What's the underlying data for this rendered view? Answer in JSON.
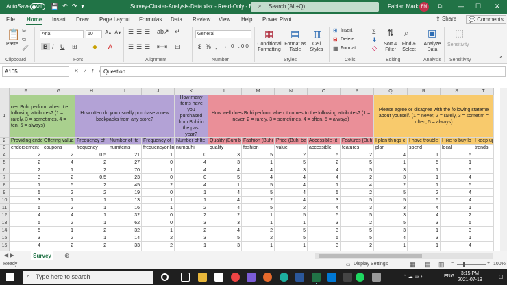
{
  "titlebar": {
    "autosave_label": "AutoSave",
    "autosave_state": "Off",
    "document_title": "Survey-Cluster-Analysis-Data.xlsx - Read-Only - Ex...",
    "search_placeholder": "Search (Alt+Q)",
    "user_name": "Fabian Marks",
    "user_initials": "FM"
  },
  "menu": {
    "tabs": [
      "File",
      "Home",
      "Insert",
      "Draw",
      "Page Layout",
      "Formulas",
      "Data",
      "Review",
      "View",
      "Help",
      "Power Pivot"
    ],
    "active_tab": "Home",
    "share_label": "Share",
    "comments_label": "Comments"
  },
  "ribbon": {
    "paste_label": "Paste",
    "font_name": "Arial",
    "font_size": "10",
    "number_format": "General",
    "conditional_formatting": "Conditional Formatting",
    "format_as_table": "Format as Table",
    "cell_styles": "Cell Styles",
    "insert_label": "Insert",
    "delete_label": "Delete",
    "format_label": "Format",
    "sort_filter": "Sort & Filter",
    "find_select": "Find & Select",
    "analyze_data": "Analyze Data",
    "sensitivity": "Sensitivity",
    "groups": [
      "Clipboard",
      "Font",
      "Alignment",
      "Number",
      "Styles",
      "Cells",
      "Editing",
      "Analysis",
      "Sensitivity"
    ]
  },
  "formula_bar": {
    "name_box": "A105",
    "content": "Question"
  },
  "grid": {
    "columns": [
      "F",
      "G",
      "H",
      "I",
      "J",
      "K",
      "L",
      "M",
      "N",
      "O",
      "P",
      "Q",
      "R",
      "S",
      "T"
    ],
    "row1_headers": {
      "FG": "oes Buhi perform when it e following attributes? (1 = rarely, 3 = sometimes, 4 = ten, 5 = always)",
      "HJ": "How often do you usually purchase a new backpacks from any store?",
      "K": "How many items have you purchased from Buhi in the past year?",
      "LP": "How well does Buhi perform when it comes to the following attributes? (1 = never, 2 = rarely, 3 = sometimes, 4 = often, 5 = always)",
      "QT": "Please agree or disagree with the following stateme about yourself. (1 = never, 2 = rarely, 3 = sometim = often, 5 = always)"
    },
    "row2": [
      "Providing endo",
      "Offering valua",
      "Frequency of",
      "Number of Ite",
      "Frequency of",
      "Number of Ite",
      "Quality (Buhi b",
      "Fashion (Buhi",
      "Price (Buhi ba",
      "Accessible (it",
      "Features (Buh",
      "I plan things c",
      "I have trouble",
      "I like to buy lo",
      "I keep up"
    ],
    "row3": [
      "endorsement",
      "coupons",
      "frequency",
      "numitems",
      "frequencyonline",
      "numbuhi",
      "quality",
      "fashion",
      "value",
      "accessible",
      "features",
      "plan",
      "spend",
      "local",
      "trends"
    ],
    "row_numbers": [
      "1",
      "2",
      "3",
      "4",
      "5",
      "6",
      "7",
      "8",
      "9",
      "10",
      "11",
      "12",
      "13",
      "14",
      "15",
      "16",
      "17",
      "18"
    ],
    "data_rows": [
      [
        "2",
        "2",
        "0.5",
        "21",
        "1",
        "0",
        "3",
        "5",
        "2",
        "5",
        "2",
        "4",
        "1",
        "5"
      ],
      [
        "2",
        "4",
        "2",
        "27",
        "0",
        "4",
        "3",
        "1",
        "5",
        "2",
        "5",
        "1",
        "5",
        "1"
      ],
      [
        "2",
        "1",
        "2",
        "70",
        "1",
        "4",
        "4",
        "4",
        "3",
        "4",
        "5",
        "3",
        "1",
        "5"
      ],
      [
        "3",
        "2",
        "0.5",
        "23",
        "0",
        "0",
        "5",
        "4",
        "4",
        "4",
        "2",
        "3",
        "1",
        "4"
      ],
      [
        "1",
        "5",
        "2",
        "45",
        "2",
        "4",
        "1",
        "5",
        "4",
        "1",
        "4",
        "2",
        "1",
        "5"
      ],
      [
        "5",
        "2",
        "2",
        "19",
        "0",
        "1",
        "4",
        "5",
        "4",
        "5",
        "2",
        "5",
        "2",
        "4"
      ],
      [
        "3",
        "1",
        "1",
        "13",
        "1",
        "1",
        "4",
        "2",
        "4",
        "3",
        "5",
        "5",
        "5",
        "4"
      ],
      [
        "5",
        "2",
        "1",
        "16",
        "1",
        "2",
        "4",
        "5",
        "2",
        "4",
        "3",
        "3",
        "4",
        "1"
      ],
      [
        "4",
        "4",
        "1",
        "32",
        "0",
        "2",
        "2",
        "1",
        "5",
        "5",
        "5",
        "3",
        "4",
        "2"
      ],
      [
        "5",
        "2",
        "1",
        "62",
        "0",
        "3",
        "3",
        "1",
        "1",
        "3",
        "2",
        "5",
        "3",
        "5"
      ],
      [
        "5",
        "1",
        "2",
        "32",
        "1",
        "2",
        "4",
        "2",
        "5",
        "3",
        "5",
        "3",
        "1",
        "3"
      ],
      [
        "3",
        "2",
        "1",
        "14",
        "2",
        "3",
        "5",
        "2",
        "5",
        "5",
        "5",
        "4",
        "3",
        "1"
      ],
      [
        "4",
        "2",
        "2",
        "33",
        "2",
        "1",
        "3",
        "1",
        "1",
        "3",
        "2",
        "1",
        "1",
        "4"
      ],
      [
        "4",
        "5",
        "2",
        "30",
        "0",
        "3",
        "2",
        "3",
        "3",
        "2",
        "5",
        "1",
        "1",
        "5"
      ],
      [
        "1",
        "4",
        "0.5",
        "63",
        "0",
        "4",
        "1",
        "1",
        "1",
        "2",
        "1",
        "1",
        "2",
        "1"
      ]
    ],
    "colors": {
      "orange_header": "#f2b05e",
      "purple_header": "#b3a2d6",
      "pink_header": "#ea8f98",
      "yellow_header": "#f8ca6c",
      "green_header": "#a9d08e"
    }
  },
  "sheet_tab": "Survey",
  "status": {
    "ready": "Ready",
    "display_settings": "Display Settings",
    "zoom": "100%"
  },
  "taskbar": {
    "search_placeholder": "Type here to search",
    "language": "ENG",
    "time": "3:15 PM",
    "date": "2021-07-19"
  }
}
